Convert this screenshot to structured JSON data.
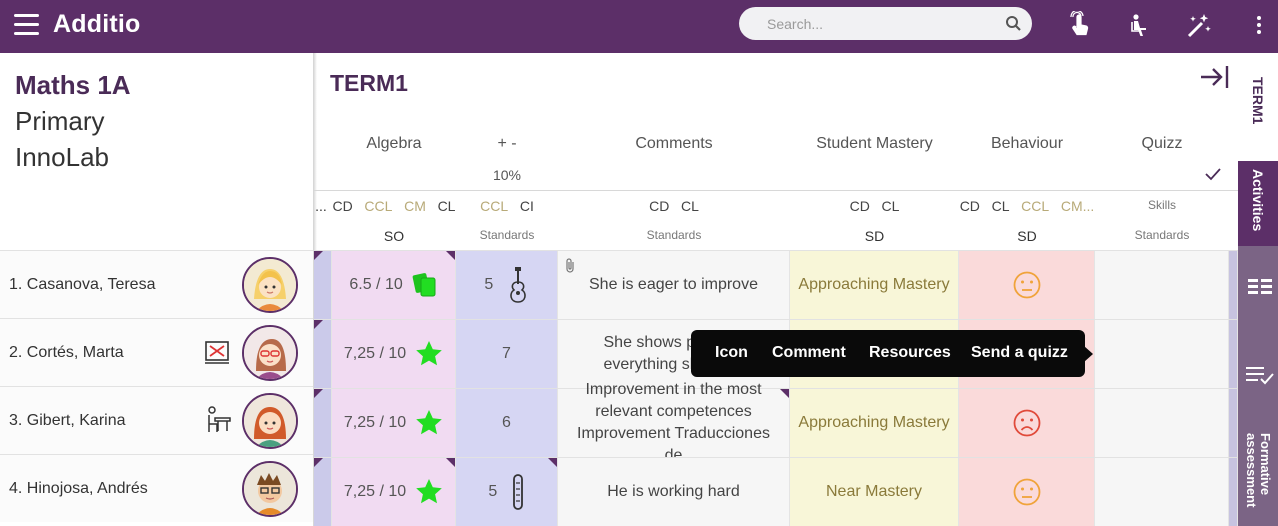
{
  "app": {
    "name": "Additio"
  },
  "search": {
    "placeholder": "Search..."
  },
  "toolbar": {
    "icons": [
      "touch-icon",
      "seat-icon",
      "magic-wand-icon",
      "more-vert-icon"
    ]
  },
  "class": {
    "name": "Maths 1A",
    "level": "Primary",
    "group": "InnoLab"
  },
  "term": {
    "title": "TERM1"
  },
  "columns": [
    {
      "title": "Algebra",
      "sub": "",
      "competences": [
        "CD",
        "CCL",
        "CM",
        "CL"
      ],
      "type": "SO"
    },
    {
      "title": "+ -",
      "sub": "10%",
      "competences": [
        "CCL",
        "CI"
      ],
      "type": "Standards"
    },
    {
      "title": "Comments",
      "sub": "",
      "competences": [
        "CD",
        "CL"
      ],
      "type": "Standards"
    },
    {
      "title": "Student Mastery",
      "sub": "",
      "competences": [
        "CD",
        "CL"
      ],
      "type": "SD"
    },
    {
      "title": "Behaviour",
      "sub": "",
      "competences": [
        "CD",
        "CL",
        "CCL",
        "CM..."
      ],
      "type": "SD"
    },
    {
      "title": "Quizz",
      "sub": "",
      "competences": [
        "Skills"
      ],
      "type": "Standards"
    }
  ],
  "leading_ellipsis": "...",
  "students": [
    {
      "name": "1. Casanova, Teresa",
      "grade": "6.5 / 10",
      "grade_icon": "green-cards-icon",
      "plusminus": "5",
      "plusminus_icon": "guitar-icon",
      "comment": "She is eager to improve",
      "mastery": "Approaching Mastery",
      "behaviour": "neutral-face-icon",
      "badge": ""
    },
    {
      "name": "2. Cortés, Marta",
      "grade": "7,25 / 10",
      "grade_icon": "green-star-icon",
      "plusminus": "7",
      "plusminus_icon": "",
      "comment": "She shows perse everything sh",
      "mastery": "",
      "behaviour": "",
      "badge": "no-tablet-icon"
    },
    {
      "name": "3. Gibert, Karina",
      "grade": "7,25 / 10",
      "grade_icon": "green-star-icon",
      "plusminus": "6",
      "plusminus_icon": "",
      "comment": "Improvement in the most relevant competences Improvement Traducciones de",
      "mastery": "Approaching Mastery",
      "behaviour": "sad-face-icon",
      "badge": "seated-desk-icon"
    },
    {
      "name": "4. Hinojosa, Andrés",
      "grade": "7,25 / 10",
      "grade_icon": "green-star-icon",
      "plusminus": "5",
      "plusminus_icon": "test-tube-icon",
      "comment": "He is working hard",
      "mastery": "Near Mastery",
      "behaviour": "neutral-face-icon",
      "badge": ""
    }
  ],
  "popup": {
    "items": [
      "Icon",
      "Comment",
      "Resources",
      "Send a quizz"
    ]
  },
  "right_tabs": [
    "TERM1",
    "Activities",
    "Formative assessment"
  ],
  "colors": {
    "header": "#5c2f68",
    "accent": "#4a2b57",
    "star": "#22dd22"
  }
}
